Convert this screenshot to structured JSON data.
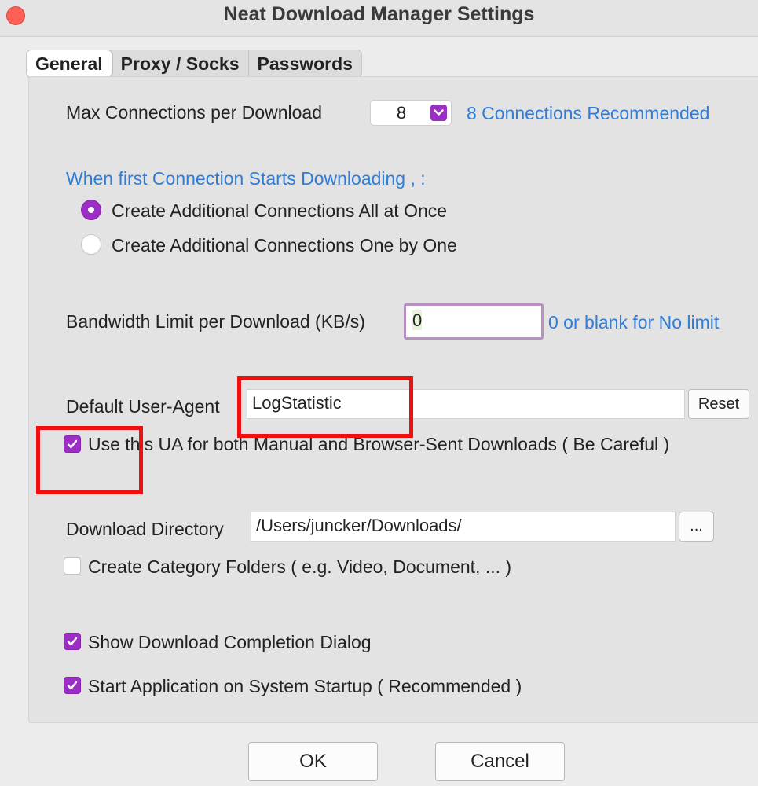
{
  "window": {
    "title": "Neat Download Manager Settings"
  },
  "tabs": [
    {
      "label": "General",
      "active": true
    },
    {
      "label": "Proxy / Socks",
      "active": false
    },
    {
      "label": "Passwords",
      "active": false
    }
  ],
  "general": {
    "max_connections_label": "Max Connections  per Download",
    "max_connections_value": "8",
    "max_connections_hint": "8 Connections Recommended",
    "first_connection_heading": "When first Connection Starts Downloading   , :",
    "radio_all_at_once": "Create Additional Connections All at Once",
    "radio_one_by_one": "Create Additional Connections One by One",
    "radio_selected": "all_at_once",
    "bandwidth_label": "Bandwidth Limit per Download (KB/s)",
    "bandwidth_value": "0",
    "bandwidth_hint": "0 or blank for No limit",
    "user_agent_label": "Default User-Agent",
    "user_agent_value": "LogStatistic",
    "reset_label": "Reset",
    "use_ua_label": "Use this UA for both Manual and Browser-Sent Downloads ( Be Careful )",
    "use_ua_checked": true,
    "download_dir_label": "Download Directory",
    "download_dir_value": "/Users/juncker/Downloads/",
    "browse_label": "...",
    "category_folders_label": "Create Category Folders ( e.g.  Video, Document, ...  )",
    "category_folders_checked": false,
    "completion_dialog_label": "Show Download Completion Dialog",
    "completion_dialog_checked": true,
    "startup_label": "Start Application on System Startup ( Recommended )",
    "startup_checked": true
  },
  "buttons": {
    "ok": "OK",
    "cancel": "Cancel"
  },
  "colors": {
    "accent": "#9b2ec4",
    "link_blue": "#2f7dd8",
    "annotation_red": "#f00f0f",
    "close_red": "#fe5f57"
  }
}
